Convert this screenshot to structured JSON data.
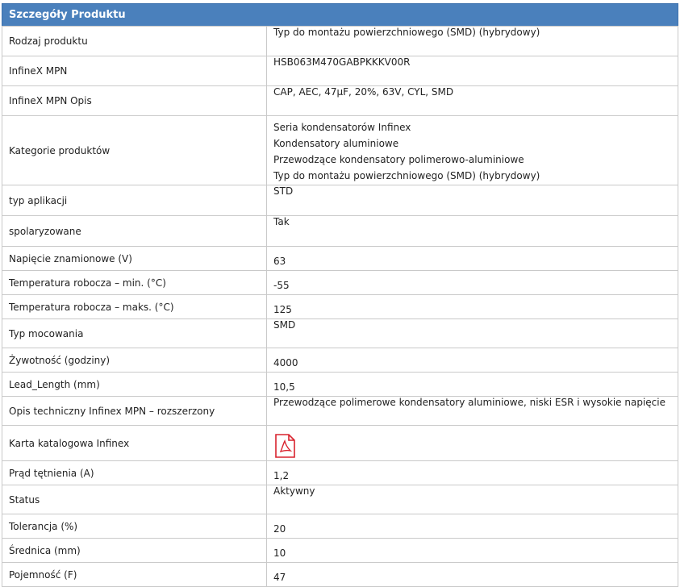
{
  "header": {
    "title": "Szczegóły Produktu"
  },
  "rows": [
    {
      "label": "Rodzaj produktu",
      "value": "Typ do montażu powierzchniowego (SMD) (hybrydowy)"
    },
    {
      "label": "InfineX MPN",
      "value": "HSB063M470GABPKKKV00R"
    },
    {
      "label": "InfineX MPN Opis",
      "value": "CAP, AEC, 47μF, 20%, 63V, CYL, SMD"
    },
    {
      "label": "Kategorie produktów",
      "values": [
        "Seria kondensatorów Infinex",
        "Kondensatory aluminiowe",
        "Przewodzące kondensatory polimerowo-aluminiowe",
        "Typ do montażu powierzchniowego (SMD) (hybrydowy)"
      ]
    },
    {
      "label": "typ aplikacji",
      "value": "STD"
    },
    {
      "label": "spolaryzowane",
      "value": "Tak"
    },
    {
      "label": "Napięcie znamionowe (V)",
      "value": "63"
    },
    {
      "label": "Temperatura robocza – min. (°C)",
      "value": "-55"
    },
    {
      "label": "Temperatura robocza – maks. (°C)",
      "value": "125"
    },
    {
      "label": "Typ mocowania",
      "value": "SMD"
    },
    {
      "label": "Żywotność (godziny)",
      "value": "4000"
    },
    {
      "label": "Lead_Length (mm)",
      "value": "10,5"
    },
    {
      "label": "Opis techniczny Infinex MPN – rozszerzony",
      "value": "Przewodzące polimerowe kondensatory aluminiowe, niski ESR i wysokie napięcie"
    },
    {
      "label": "Karta katalogowa Infinex",
      "icon": "pdf-icon",
      "icon_color": "#d9232e"
    },
    {
      "label": "Prąd tętnienia (A)",
      "value": "1,2"
    },
    {
      "label": "Status",
      "value": "Aktywny"
    },
    {
      "label": "Tolerancja (%)",
      "value": "20"
    },
    {
      "label": "Średnica (mm)",
      "value": "10"
    },
    {
      "label": "Pojemność (F)",
      "value": "47"
    }
  ],
  "colors": {
    "header_bg": "#4a80bc",
    "border": "#c9c9c9",
    "pdf_icon": "#d9232e"
  }
}
